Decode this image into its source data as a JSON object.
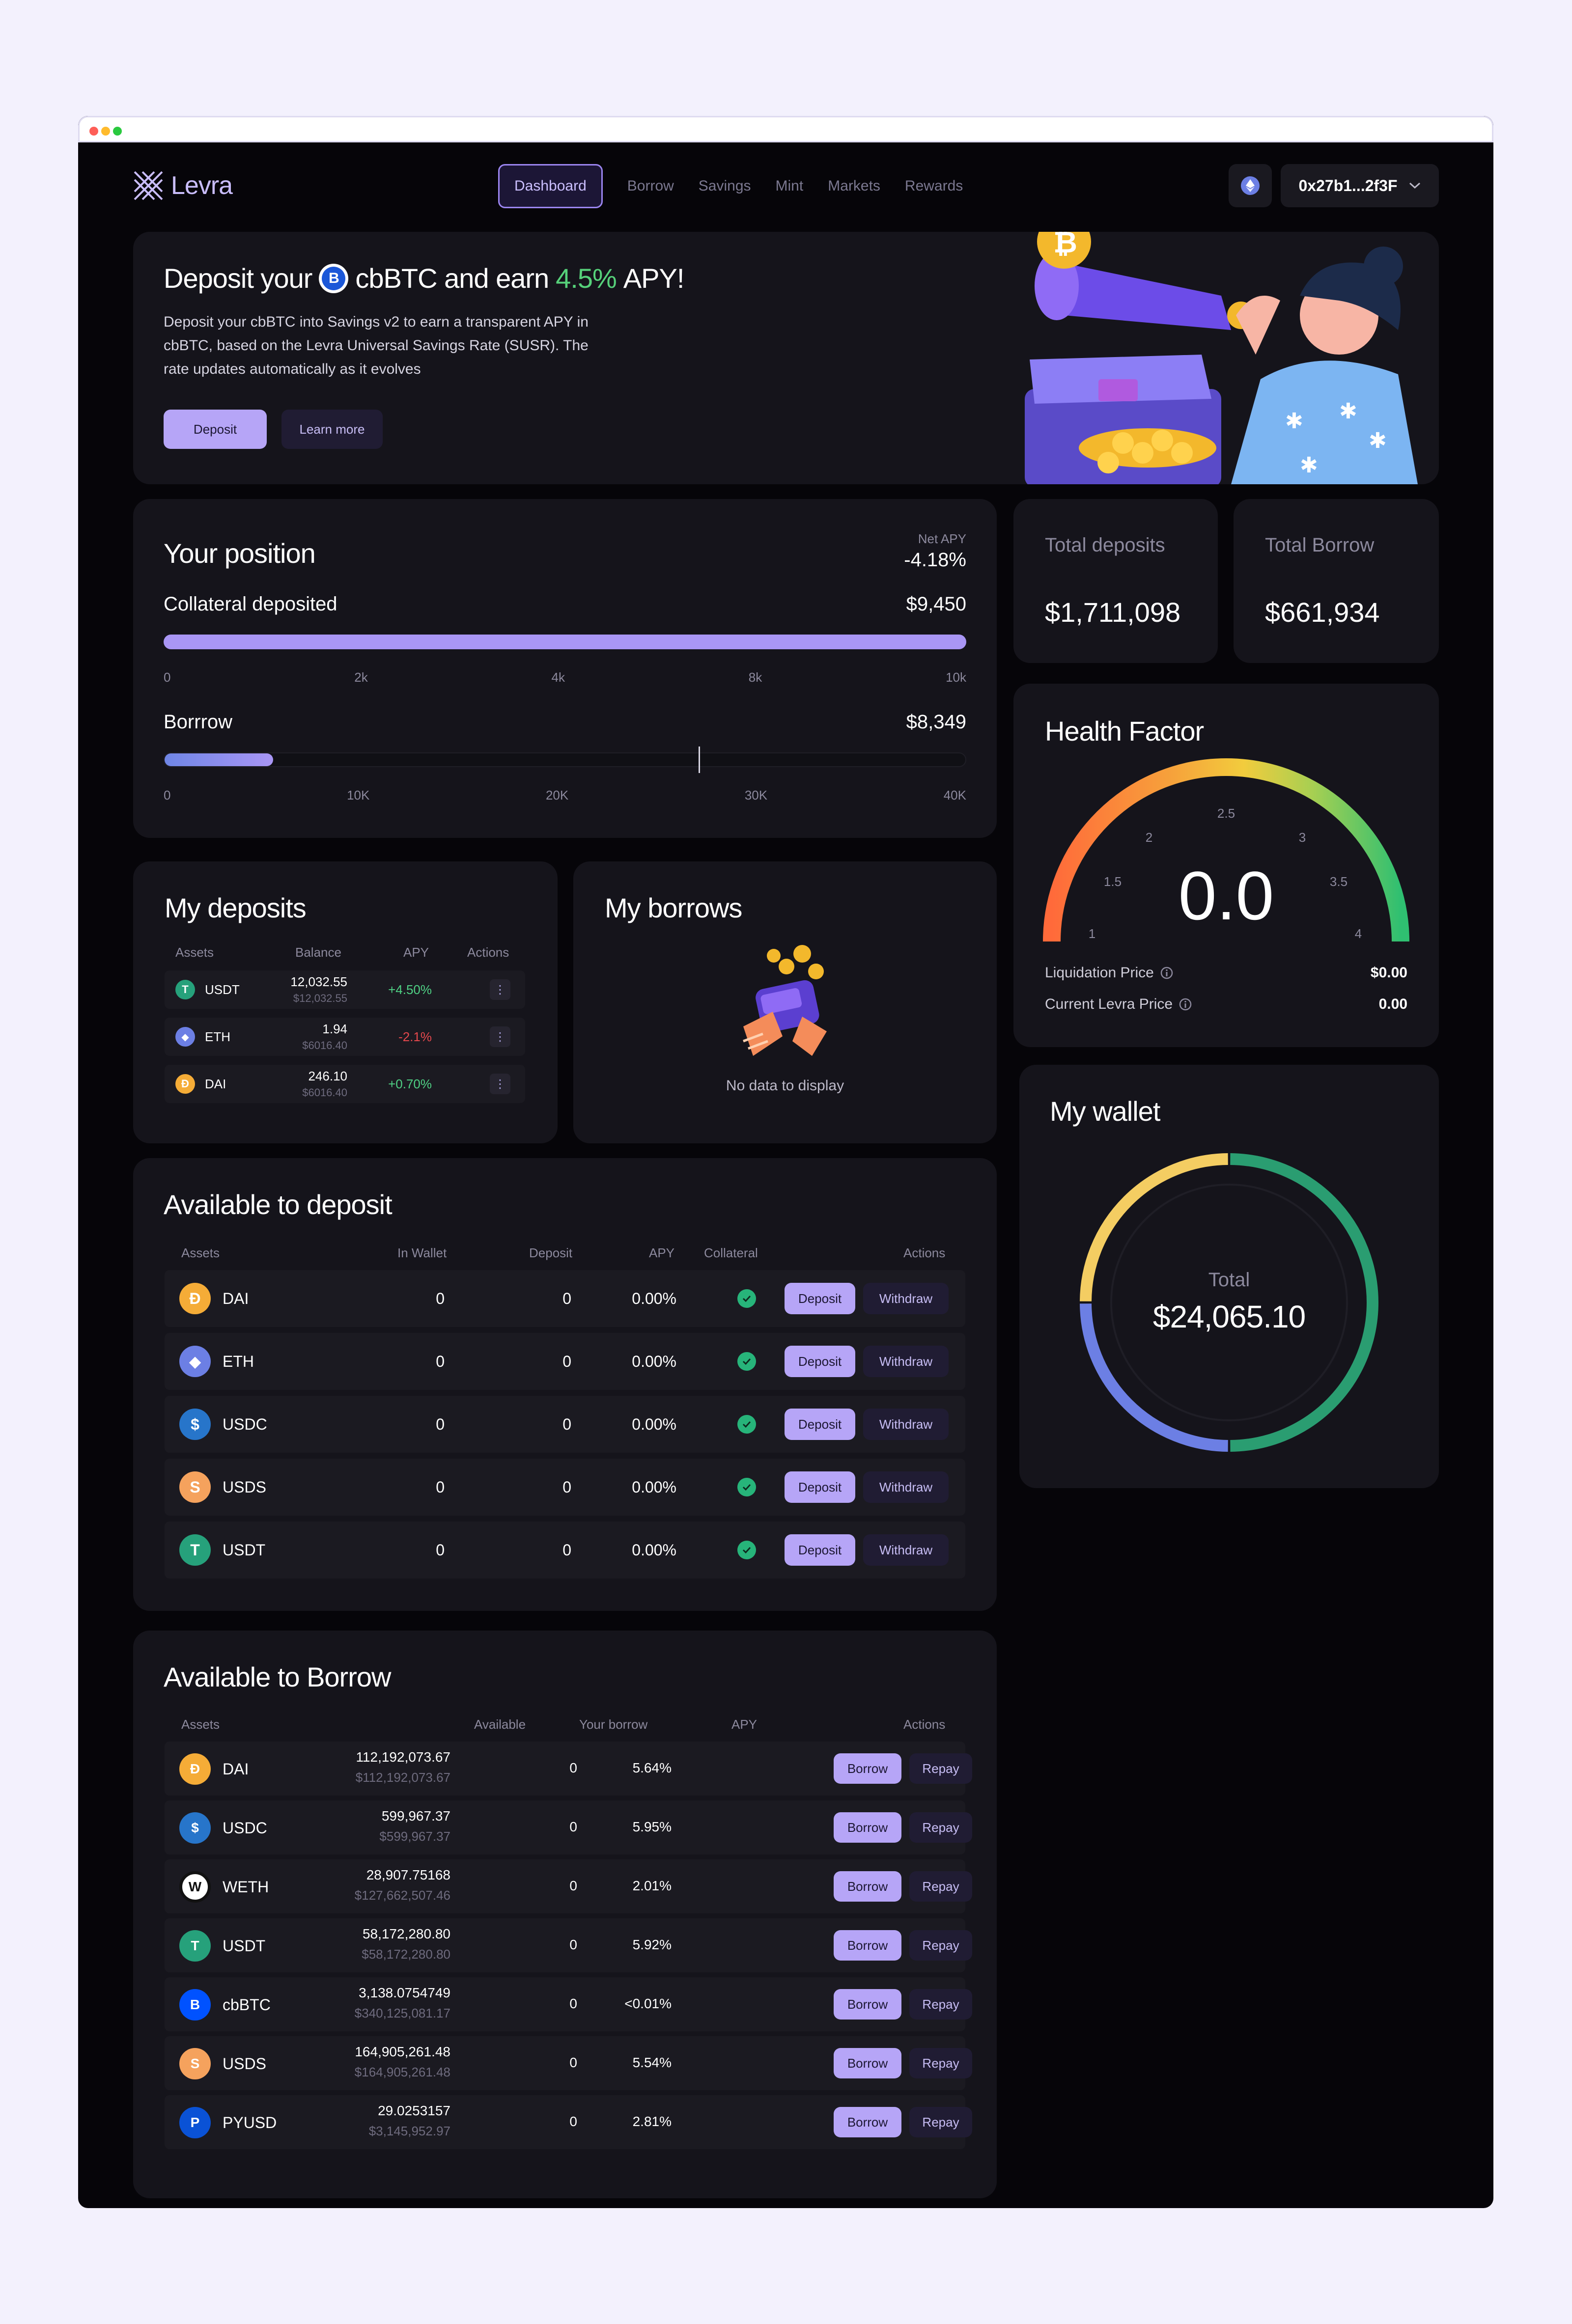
{
  "brand": {
    "name": "Levra"
  },
  "nav": {
    "items": [
      "Dashboard",
      "Borrow",
      "Savings",
      "Mint",
      "Markets",
      "Rewards"
    ],
    "active": "Dashboard"
  },
  "wallet_button": {
    "address": "0x27b1...2f3F"
  },
  "hero": {
    "title_pre": "Deposit your",
    "title_token": "cbBTC and earn",
    "title_apy": "4.5%",
    "title_post": "APY!",
    "description": "Deposit your cbBTC into Savings v2 to earn a transparent APY in cbBTC, based on the Levra Universal Savings Rate (SUSR). The rate updates automatically as it evolves",
    "deposit_label": "Deposit",
    "learn_more_label": "Learn more"
  },
  "position": {
    "title": "Your position",
    "net_apy_label": "Net APY",
    "net_apy_value": "-4.18%",
    "collateral_label": "Collateral deposited",
    "collateral_value": "$9,450",
    "collateral_fraction": 1.0,
    "collateral_ticks": [
      "0",
      "2k",
      "4k",
      "8k",
      "10k"
    ],
    "borrow_label": "Borrrow",
    "borrow_value": "$8,349",
    "borrow_fraction": 0.135,
    "borrow_marker_fraction": 0.665,
    "borrow_ticks": [
      "0",
      "10K",
      "20K",
      "30K",
      "40K"
    ]
  },
  "stats": {
    "total_deposits_label": "Total deposits",
    "total_deposits_value": "$1,711,098",
    "total_borrow_label": "Total Borrow",
    "total_borrow_value": "$661,934"
  },
  "health": {
    "title": "Health Factor",
    "value": "0.0",
    "gauge_ticks": [
      "1",
      "1.5",
      "2",
      "2.5",
      "3",
      "3.5",
      "4"
    ],
    "liquidation_label": "Liquidation Price",
    "liquidation_value": "$0.00",
    "current_price_label": "Current Levra Price",
    "current_price_value": "0.00"
  },
  "my_deposits": {
    "title": "My deposits",
    "columns": [
      "Assets",
      "Balance",
      "APY",
      "Actions"
    ],
    "rows": [
      {
        "asset": "USDT",
        "balance": "12,032.55",
        "balance_usd": "$12,032.55",
        "apy": "+4.50%",
        "apy_color": "#4fd084",
        "coin_color": "#26a17b",
        "coin_glyph": "T"
      },
      {
        "asset": "ETH",
        "balance": "1.94",
        "balance_usd": "$6016.40",
        "apy": "-2.1%",
        "apy_color": "#e5484d",
        "coin_color": "#6c7fe4",
        "coin_glyph": "◆"
      },
      {
        "asset": "DAI",
        "balance": "246.10",
        "balance_usd": "$6016.40",
        "apy": "+0.70%",
        "apy_color": "#4fd084",
        "coin_color": "#f5ac37",
        "coin_glyph": "D"
      }
    ]
  },
  "my_borrows": {
    "title": "My borrows",
    "empty_text": "No data to display"
  },
  "my_wallet": {
    "title": "My wallet",
    "total_label": "Total",
    "total_value": "$24,065.10",
    "segments": [
      {
        "name": "green",
        "fraction": 0.5,
        "color": "#2a9d71"
      },
      {
        "name": "blue",
        "fraction": 0.25,
        "color": "#6c7fe4"
      },
      {
        "name": "yellow",
        "fraction": 0.25,
        "color": "#f4cd62"
      }
    ]
  },
  "available_to_deposit": {
    "title": "Available to deposit",
    "columns": [
      "Assets",
      "In Wallet",
      "Deposit",
      "APY",
      "Collateral",
      "Actions"
    ],
    "deposit_label": "Deposit",
    "withdraw_label": "Withdraw",
    "rows": [
      {
        "asset": "DAI",
        "in_wallet": "0",
        "deposit": "0",
        "apy": "0.00%",
        "coin_color": "#f5ac37",
        "coin_glyph": "Ð"
      },
      {
        "asset": "ETH",
        "in_wallet": "0",
        "deposit": "0",
        "apy": "0.00%",
        "coin_color": "#6c7fe4",
        "coin_glyph": "◆"
      },
      {
        "asset": "USDC",
        "in_wallet": "0",
        "deposit": "0",
        "apy": "0.00%",
        "coin_color": "#2775ca",
        "coin_glyph": "$"
      },
      {
        "asset": "USDS",
        "in_wallet": "0",
        "deposit": "0",
        "apy": "0.00%",
        "coin_color": "#f5a25d",
        "coin_glyph": "S"
      },
      {
        "asset": "USDT",
        "in_wallet": "0",
        "deposit": "0",
        "apy": "0.00%",
        "coin_color": "#26a17b",
        "coin_glyph": "T"
      }
    ]
  },
  "available_to_borrow": {
    "title": "Available to Borrow",
    "columns": [
      "Assets",
      "Available",
      "Your borrow",
      "APY",
      "Actions"
    ],
    "borrow_label": "Borrow",
    "repay_label": "Repay",
    "rows": [
      {
        "asset": "DAI",
        "available": "112,192,073.67",
        "available_usd": "$112,192,073.67",
        "your_borrow": "0",
        "apy": "5.64%",
        "coin_color": "#f5ac37",
        "coin_glyph": "Ð"
      },
      {
        "asset": "USDC",
        "available": "599,967.37",
        "available_usd": "$599,967.37",
        "your_borrow": "0",
        "apy": "5.95%",
        "coin_color": "#2775ca",
        "coin_glyph": "$"
      },
      {
        "asset": "WETH",
        "available": "28,907.75168",
        "available_usd": "$127,662,507.46",
        "your_borrow": "0",
        "apy": "2.01%",
        "coin_color": "#ffffff",
        "coin_glyph": "W"
      },
      {
        "asset": "USDT",
        "available": "58,172,280.80",
        "available_usd": "$58,172,280.80",
        "your_borrow": "0",
        "apy": "5.92%",
        "coin_color": "#26a17b",
        "coin_glyph": "T"
      },
      {
        "asset": "cbBTC",
        "available": "3,138.0754749",
        "available_usd": "$340,125,081.17",
        "your_borrow": "0",
        "apy": "<0.01%",
        "coin_color": "#0052ff",
        "coin_glyph": "B"
      },
      {
        "asset": "USDS",
        "available": "164,905,261.48",
        "available_usd": "$164,905,261.48",
        "your_borrow": "0",
        "apy": "5.54%",
        "coin_color": "#f5a25d",
        "coin_glyph": "S"
      },
      {
        "asset": "PYUSD",
        "available": "29.0253157",
        "available_usd": "$3,145,952.97",
        "your_borrow": "0",
        "apy": "2.81%",
        "coin_color": "#0a52d6",
        "coin_glyph": "P"
      }
    ]
  }
}
